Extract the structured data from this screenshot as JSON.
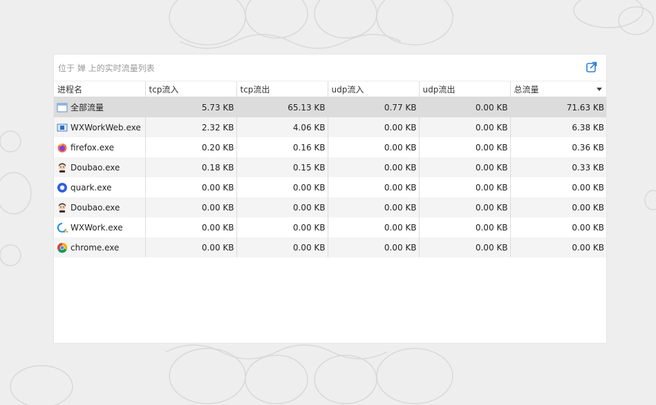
{
  "panel": {
    "title": "位于 婵 上的实时流量列表",
    "export_icon": "export-icon"
  },
  "table": {
    "columns": [
      "进程名",
      "tcp流入",
      "tcp流出",
      "udp流入",
      "udp流出",
      "总流量"
    ],
    "sorted_column": "总流量",
    "rows": [
      {
        "icon": "window-icon",
        "name": "全部流量",
        "tcp_in": "5.73 KB",
        "tcp_out": "65.13 KB",
        "udp_in": "0.77 KB",
        "udp_out": "0.00 KB",
        "total": "71.63 KB"
      },
      {
        "icon": "wxwork-web-icon",
        "name": "WXWorkWeb.exe",
        "tcp_in": "2.32 KB",
        "tcp_out": "4.06 KB",
        "udp_in": "0.00 KB",
        "udp_out": "0.00 KB",
        "total": "6.38 KB"
      },
      {
        "icon": "firefox-icon",
        "name": "firefox.exe",
        "tcp_in": "0.20 KB",
        "tcp_out": "0.16 KB",
        "udp_in": "0.00 KB",
        "udp_out": "0.00 KB",
        "total": "0.36 KB"
      },
      {
        "icon": "doubao-icon",
        "name": "Doubao.exe",
        "tcp_in": "0.18 KB",
        "tcp_out": "0.15 KB",
        "udp_in": "0.00 KB",
        "udp_out": "0.00 KB",
        "total": "0.33 KB"
      },
      {
        "icon": "quark-icon",
        "name": "quark.exe",
        "tcp_in": "0.00 KB",
        "tcp_out": "0.00 KB",
        "udp_in": "0.00 KB",
        "udp_out": "0.00 KB",
        "total": "0.00 KB"
      },
      {
        "icon": "doubao-icon",
        "name": "Doubao.exe",
        "tcp_in": "0.00 KB",
        "tcp_out": "0.00 KB",
        "udp_in": "0.00 KB",
        "udp_out": "0.00 KB",
        "total": "0.00 KB"
      },
      {
        "icon": "wxwork-icon",
        "name": "WXWork.exe",
        "tcp_in": "0.00 KB",
        "tcp_out": "0.00 KB",
        "udp_in": "0.00 KB",
        "udp_out": "0.00 KB",
        "total": "0.00 KB"
      },
      {
        "icon": "chrome-icon",
        "name": "chrome.exe",
        "tcp_in": "0.00 KB",
        "tcp_out": "0.00 KB",
        "udp_in": "0.00 KB",
        "udp_out": "0.00 KB",
        "total": "0.00 KB"
      }
    ]
  },
  "colors": {
    "background": "#eeeeee",
    "selected_row": "#dcdcdc",
    "alt_row": "#f4f4f4",
    "accent": "#2f7fd8"
  }
}
